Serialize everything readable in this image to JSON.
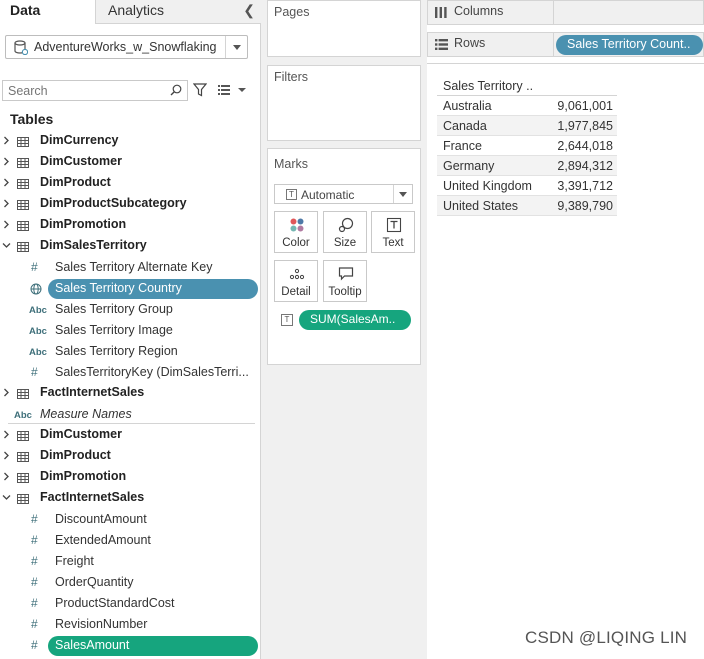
{
  "tabs": {
    "data": "Data",
    "analytics": "Analytics"
  },
  "datasource": {
    "name": "AdventureWorks_w_Snowflaking"
  },
  "search": {
    "placeholder": "Search"
  },
  "tables_title": "Tables",
  "tree": [
    {
      "type": "table",
      "label": "DimCurrency",
      "expanded": false
    },
    {
      "type": "table",
      "label": "DimCustomer",
      "expanded": false
    },
    {
      "type": "table",
      "label": "DimProduct",
      "expanded": false
    },
    {
      "type": "table",
      "label": "DimProductSubcategory",
      "expanded": false
    },
    {
      "type": "table",
      "label": "DimPromotion",
      "expanded": false
    },
    {
      "type": "table",
      "label": "DimSalesTerritory",
      "expanded": true
    },
    {
      "type": "field",
      "icon": "number-icon",
      "label": "Sales Territory Alternate Key"
    },
    {
      "type": "field",
      "icon": "globe-icon",
      "label": "Sales Territory Country",
      "selected": "blue"
    },
    {
      "type": "field",
      "icon": "abc-icon",
      "label": "Sales Territory Group"
    },
    {
      "type": "field",
      "icon": "abc-icon",
      "label": "Sales Territory Image"
    },
    {
      "type": "field",
      "icon": "abc-icon",
      "label": "Sales Territory Region"
    },
    {
      "type": "field",
      "icon": "number-icon",
      "label": "SalesTerritoryKey (DimSalesTerri..."
    },
    {
      "type": "table",
      "label": "FactInternetSales",
      "expanded": false
    },
    {
      "type": "measure",
      "icon": "abc-icon",
      "label": "Measure Names"
    },
    {
      "type": "table",
      "label": "DimCustomer",
      "expanded": false
    },
    {
      "type": "table",
      "label": "DimProduct",
      "expanded": false
    },
    {
      "type": "table",
      "label": "DimPromotion",
      "expanded": false
    },
    {
      "type": "table",
      "label": "FactInternetSales",
      "expanded": true
    },
    {
      "type": "field",
      "icon": "number-icon",
      "label": "DiscountAmount"
    },
    {
      "type": "field",
      "icon": "number-icon",
      "label": "ExtendedAmount"
    },
    {
      "type": "field",
      "icon": "number-icon",
      "label": "Freight"
    },
    {
      "type": "field",
      "icon": "number-icon",
      "label": "OrderQuantity"
    },
    {
      "type": "field",
      "icon": "number-icon",
      "label": "ProductStandardCost"
    },
    {
      "type": "field",
      "icon": "number-icon",
      "label": "RevisionNumber"
    },
    {
      "type": "field",
      "icon": "number-icon",
      "label": "SalesAmount",
      "selected": "green"
    }
  ],
  "cards": {
    "pages": "Pages",
    "filters": "Filters",
    "marks": "Marks"
  },
  "marks": {
    "type": "Automatic",
    "buttons": {
      "color": "Color",
      "size": "Size",
      "text": "Text",
      "detail": "Detail",
      "tooltip": "Tooltip"
    },
    "pill": "SUM(SalesAm.."
  },
  "shelves": {
    "columns": "Columns",
    "rows": "Rows",
    "rows_pill": "Sales Territory Count.."
  },
  "view": {
    "header": "Sales Territory ..",
    "rows": [
      {
        "country": "Australia",
        "value": "9,061,001"
      },
      {
        "country": "Canada",
        "value": "1,977,845"
      },
      {
        "country": "France",
        "value": "2,644,018"
      },
      {
        "country": "Germany",
        "value": "2,894,312"
      },
      {
        "country": "United Kingdom",
        "value": "3,391,712"
      },
      {
        "country": "United States",
        "value": "9,389,790"
      }
    ]
  },
  "watermark": "CSDN @LIQING LIN",
  "colors": {
    "selected_blue": "#4a91b0",
    "selected_green": "#16a57e"
  }
}
